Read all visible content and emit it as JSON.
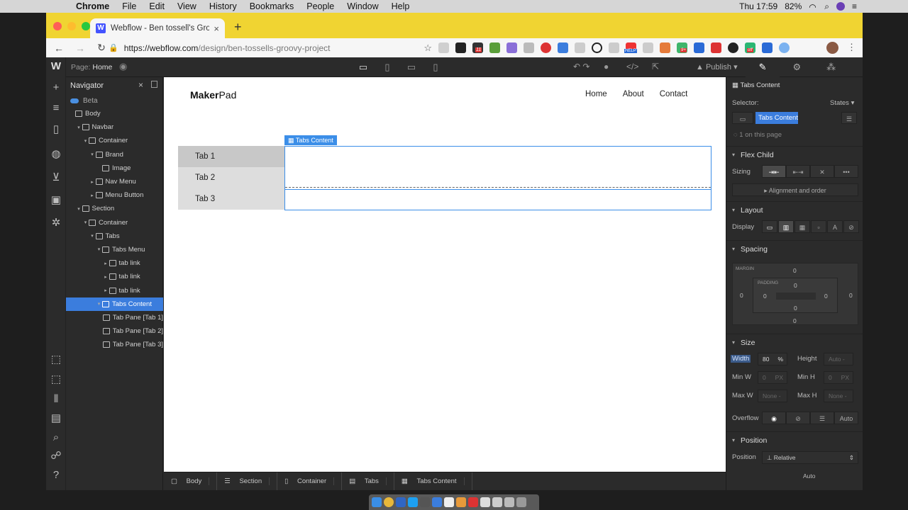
{
  "mac_menubar": {
    "app_name": "Chrome",
    "menus": [
      "File",
      "Edit",
      "View",
      "History",
      "Bookmarks",
      "People",
      "Window",
      "Help"
    ],
    "battery": "82%",
    "clock": "Thu 17:59"
  },
  "browser": {
    "tab_title": "Webflow - Ben tossell's Groovy",
    "url_host": "https://webflow.com",
    "url_path": "/design/ben-tossells-groovy-project",
    "ext_help_badge": "HELP",
    "ext_count_badge": "11",
    "ext_off_badge": "off",
    "ext_plus_badge": "9+"
  },
  "designer": {
    "page_label": "Page:",
    "page_name": "Home",
    "publish_label": "Publish",
    "navigator": {
      "title": "Navigator",
      "beta_label": "Beta",
      "tree": [
        {
          "label": "Body",
          "depth": 0,
          "caret": ""
        },
        {
          "label": "Navbar",
          "depth": 1,
          "caret": "▾"
        },
        {
          "label": "Container",
          "depth": 2,
          "caret": "▾"
        },
        {
          "label": "Brand",
          "depth": 3,
          "caret": "▾"
        },
        {
          "label": "Image",
          "depth": 4,
          "caret": ""
        },
        {
          "label": "Nav Menu",
          "depth": 3,
          "caret": "▸"
        },
        {
          "label": "Menu Button",
          "depth": 3,
          "caret": "▸"
        },
        {
          "label": "Section",
          "depth": 1,
          "caret": "▾"
        },
        {
          "label": "Container",
          "depth": 2,
          "caret": "▾"
        },
        {
          "label": "Tabs",
          "depth": 3,
          "caret": "▾"
        },
        {
          "label": "Tabs Menu",
          "depth": 4,
          "caret": "▾"
        },
        {
          "label": "tab link",
          "depth": 5,
          "caret": "▸"
        },
        {
          "label": "tab link",
          "depth": 5,
          "caret": "▸"
        },
        {
          "label": "tab link",
          "depth": 5,
          "caret": "▸"
        },
        {
          "label": "Tabs Content",
          "depth": 4,
          "caret": "▾",
          "selected": true
        },
        {
          "label": "Tab Pane [Tab 1]",
          "depth": 5,
          "caret": ""
        },
        {
          "label": "Tab Pane [Tab 2]",
          "depth": 5,
          "caret": ""
        },
        {
          "label": "Tab Pane [Tab 3]",
          "depth": 5,
          "caret": ""
        }
      ]
    },
    "canvas": {
      "brand_bold": "Maker",
      "brand_rest": "Pad",
      "nav_links": [
        "Home",
        "About",
        "Contact"
      ],
      "tabs": [
        "Tab 1",
        "Tab 2",
        "Tab 3"
      ],
      "selection_tag": "Tabs Content"
    },
    "breadcrumbs": [
      "Body",
      "Section",
      "Container",
      "Tabs",
      "Tabs Content"
    ],
    "style_panel": {
      "element_name": "Tabs Content",
      "selector_label": "Selector:",
      "states_label": "States",
      "class_chip": "Tabs Content",
      "on_page": "1 on this page",
      "flex_child": "Flex Child",
      "sizing_label": "Sizing",
      "alignment_label": "Alignment and order",
      "layout": "Layout",
      "display_label": "Display",
      "spacing": "Spacing",
      "margin_label": "MARGIN",
      "padding_label": "PADDING",
      "margin_values": {
        "top": "0",
        "right": "0",
        "bottom": "0",
        "left": "0"
      },
      "padding_values": {
        "top": "0",
        "right": "0",
        "bottom": "0",
        "left": "0"
      },
      "size": "Size",
      "width_label": "Width",
      "width_value": "80",
      "width_unit": "%",
      "height_label": "Height",
      "height_value": "Auto",
      "minw_label": "Min W",
      "minw_value": "0",
      "minw_unit": "PX",
      "minh_label": "Min H",
      "minh_value": "0",
      "minh_unit": "PX",
      "maxw_label": "Max W",
      "maxw_value": "None",
      "maxh_label": "Max H",
      "maxh_value": "None",
      "overflow_label": "Overflow",
      "overflow_auto": "Auto",
      "position": "Position",
      "position_label": "Position",
      "position_value": "Relative",
      "position_auto": "Auto"
    }
  }
}
